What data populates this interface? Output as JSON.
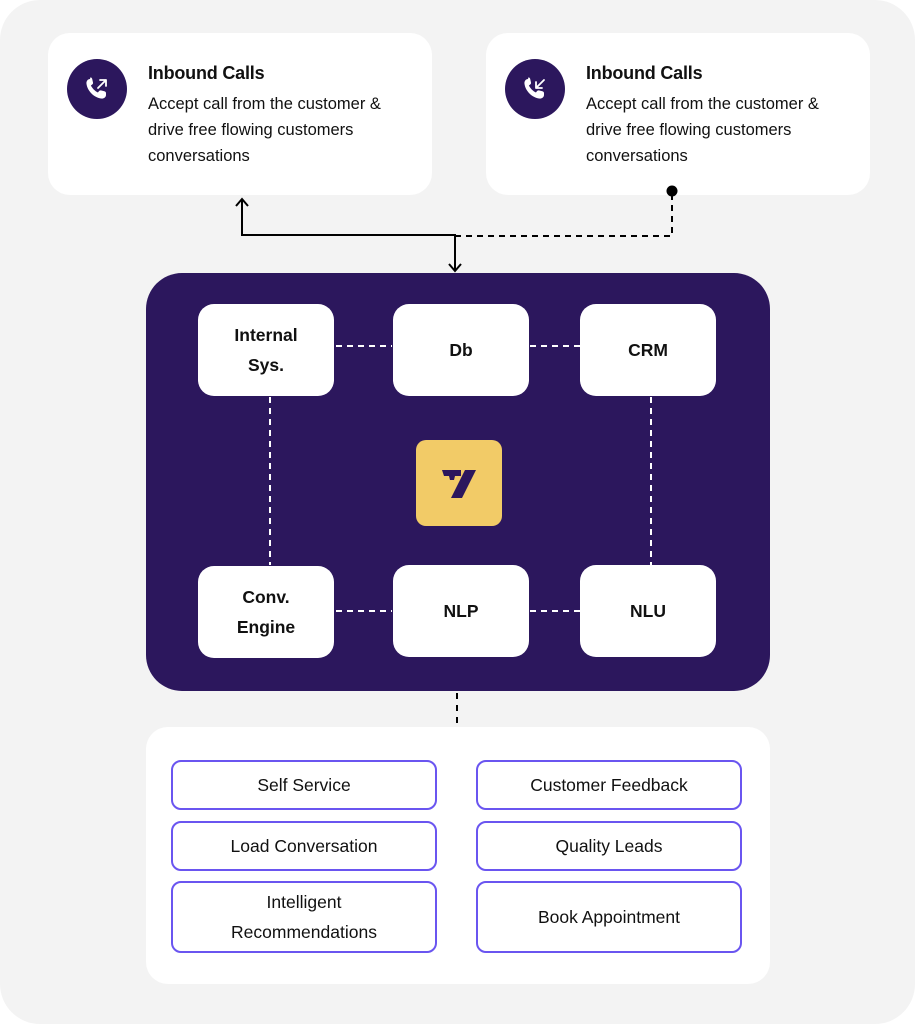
{
  "call_cards": [
    {
      "icon": "phone-outgoing-icon",
      "title": "Inbound Calls",
      "description": "Accept call from the customer & drive free flowing customers conversations"
    },
    {
      "icon": "phone-incoming-icon",
      "title": "Inbound Calls",
      "description": "Accept call from the customer & drive free flowing customers conversations"
    }
  ],
  "hub": {
    "logo_icon": "brand-logo-icon",
    "nodes": [
      {
        "label": "Internal\nSys."
      },
      {
        "label": "Db"
      },
      {
        "label": "CRM"
      },
      {
        "label": "Conv.\nEngine"
      },
      {
        "label": "NLP"
      },
      {
        "label": "NLU"
      }
    ]
  },
  "use_cases": [
    {
      "label": "Self Service"
    },
    {
      "label": "Customer Feedback"
    },
    {
      "label": "Load Conversation"
    },
    {
      "label": "Quality Leads"
    },
    {
      "label": "Intelligent\nRecommendations"
    },
    {
      "label": "Book Appointment"
    }
  ],
  "colors": {
    "background": "#f3f3f3",
    "hub": "#2c175d",
    "logo": "#f2cb67",
    "usecase_border": "#6a55f0"
  }
}
